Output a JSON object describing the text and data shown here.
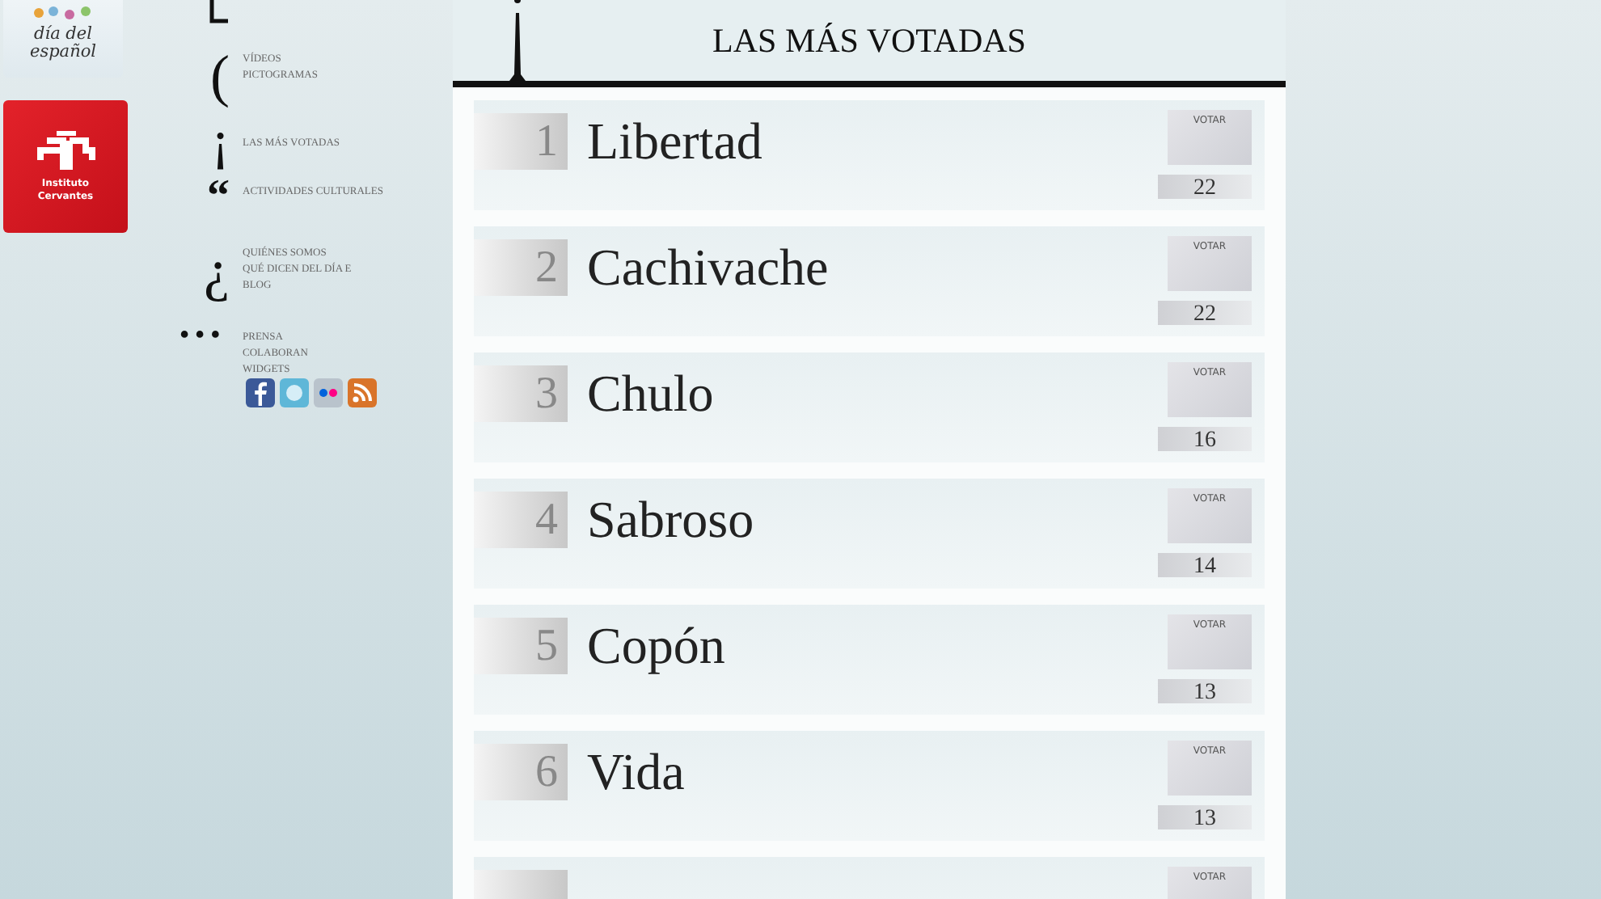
{
  "logos": {
    "top_card": "día del español",
    "institute": "Instituto Cervantes"
  },
  "nav": [
    {
      "glyph": "(",
      "lines": [
        "VÍDEOS",
        "PICTOGRAMAS"
      ]
    },
    {
      "glyph": "¡",
      "lines": [
        "LAS MÁS VOTADAS"
      ]
    },
    {
      "glyph": "“",
      "lines": [
        "ACTIVIDADES CULTURALES"
      ]
    },
    {
      "glyph": "¿",
      "lines": [
        "QUIÉNES SOMOS",
        "QUÉ DICEN DEL DÍA E",
        "BLOG"
      ]
    },
    {
      "glyph": "• • •",
      "lines": [
        "PRENSA",
        "COLABORAN",
        "WIDGETS"
      ]
    }
  ],
  "social": [
    {
      "kind": "facebook"
    },
    {
      "kind": "twitter"
    },
    {
      "kind": "flickr"
    },
    {
      "kind": "rss"
    }
  ],
  "heading": "LAS MÁS VOTADAS",
  "ranking": [
    {
      "rank": "1",
      "word": "Libertad",
      "vote": "VOTAR",
      "count": "22"
    },
    {
      "rank": "2",
      "word": "Cachivache",
      "vote": "VOTAR",
      "count": "22"
    },
    {
      "rank": "3",
      "word": "Chulo",
      "vote": "VOTAR",
      "count": "16"
    },
    {
      "rank": "4",
      "word": "Sabroso",
      "vote": "VOTAR",
      "count": "14"
    },
    {
      "rank": "5",
      "word": "Copón",
      "vote": "VOTAR",
      "count": "13"
    },
    {
      "rank": "6",
      "word": "Vida",
      "vote": "VOTAR",
      "count": "13"
    },
    {
      "vote": "VOTAR"
    }
  ]
}
